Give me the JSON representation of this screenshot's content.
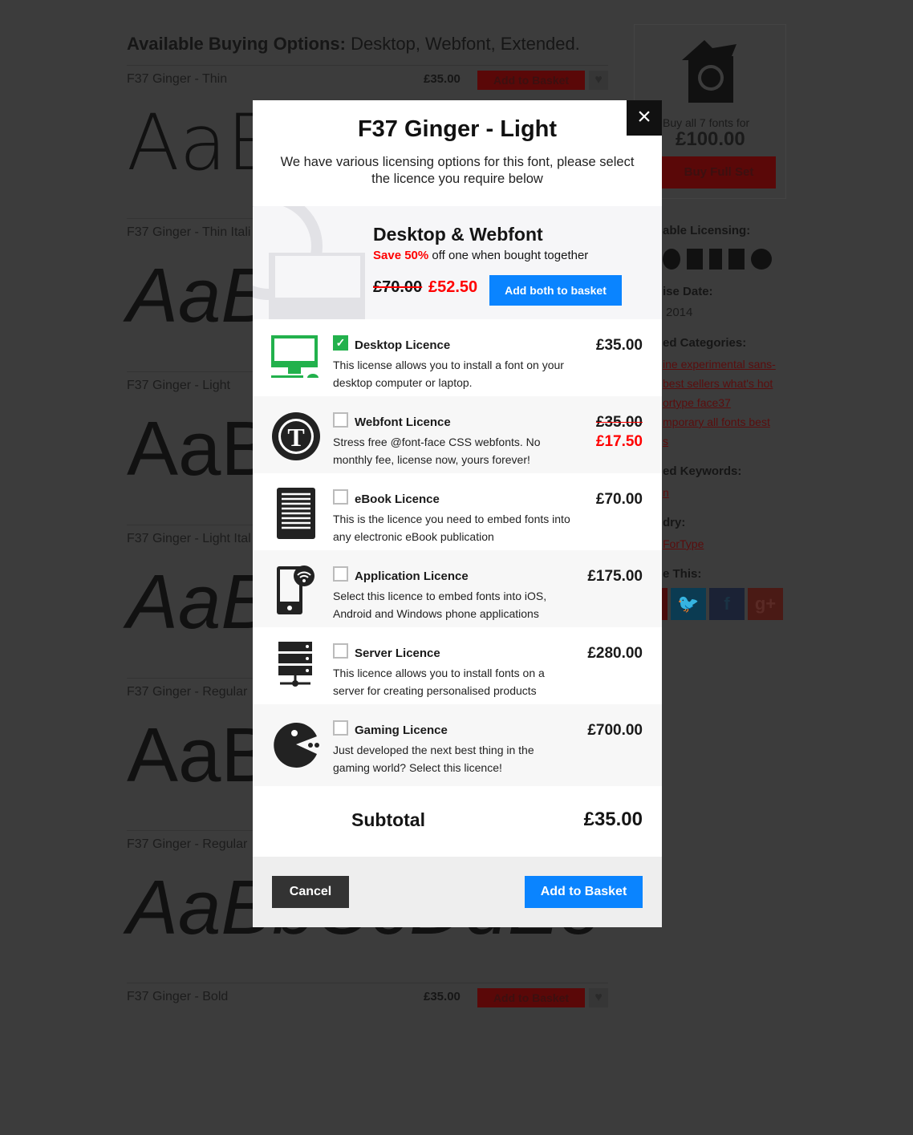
{
  "page": {
    "heading_bold": "Available Buying Options:",
    "heading_rest": " Desktop, Webfont, Extended.",
    "fonts": [
      {
        "name": "F37 Ginger - Thin",
        "price": "£35.00",
        "button": "Add to Basket",
        "sample": "AaB"
      },
      {
        "name": "F37 Ginger - Thin Itali",
        "sample": "AaB"
      },
      {
        "name": "F37 Ginger - Light",
        "sample": "AaB"
      },
      {
        "name": "F37 Ginger - Light Ital",
        "sample": "AaB"
      },
      {
        "name": "F37 Ginger - Regular",
        "sample": "AaB"
      },
      {
        "name": "F37 Ginger - Regular",
        "sample": "AaBbCcDdEe"
      },
      {
        "name": "F37 Ginger - Bold",
        "price": "£35.00",
        "button": "Add to Basket"
      }
    ]
  },
  "sidebar": {
    "buy_all": "Buy all 7 fonts for",
    "full_price": "£100.00",
    "full_set_button": "Buy Full Set",
    "licensing_label": "able Licensing:",
    "release_label": "ise Date:",
    "release_value": "2014",
    "categories_label": "ed Categories:",
    "category_lines": [
      "ine experimental sans-",
      "best sellers what's hot",
      "ortype face37",
      "mporary all fonts best",
      "s"
    ],
    "keywords_label": "ed Keywords:",
    "keyword": "n",
    "foundry_label": "dry:",
    "foundry": "ForType",
    "share_label": "e This:"
  },
  "modal": {
    "title": "F37 Ginger - Light",
    "subtitle": "We have various licensing options for this font, please select the licence you require below",
    "close_icon": "×",
    "bundle": {
      "title": "Desktop & Webfont",
      "save": "Save 50%",
      "save_rest": " off one when bought together",
      "old_price": "£70.00",
      "new_price": "£52.50",
      "button": "Add both to basket"
    },
    "licences": [
      {
        "title": "Desktop Licence",
        "desc": "This license allows you to install a font on your desktop computer or laptop.",
        "price": "£35.00",
        "checked": true,
        "icon": "desktop-icon"
      },
      {
        "title": "Webfont Licence",
        "desc": "Stress free @font-face CSS webfonts. No monthly fee, license now, yours forever!",
        "price": "£35.00",
        "sale_price": "£17.50",
        "checked": false,
        "icon": "webfont-icon"
      },
      {
        "title": "eBook Licence",
        "desc": "This is the licence you need to embed fonts into any electronic eBook publication",
        "price": "£70.00",
        "checked": false,
        "icon": "ebook-icon"
      },
      {
        "title": "Application Licence",
        "desc": "Select this licence to embed fonts into iOS, Android and Windows phone applications",
        "price": "£175.00",
        "checked": false,
        "icon": "mobile-app-icon"
      },
      {
        "title": "Server Licence",
        "desc": "This licence allows you to install fonts on a server for creating personalised products",
        "price": "£280.00",
        "checked": false,
        "icon": "server-icon"
      },
      {
        "title": "Gaming Licence",
        "desc": "Just developed the next best thing in the gaming world? Select this licence!",
        "price": "£700.00",
        "checked": false,
        "icon": "pacman-icon"
      }
    ],
    "subtotal_label": "Subtotal",
    "subtotal": "£35.00",
    "cancel": "Cancel",
    "add": "Add to Basket"
  },
  "colors": {
    "accent_blue": "#0a84ff",
    "red": "#ff0000",
    "green": "#22b14c",
    "overlay": "#3c3c3c"
  }
}
